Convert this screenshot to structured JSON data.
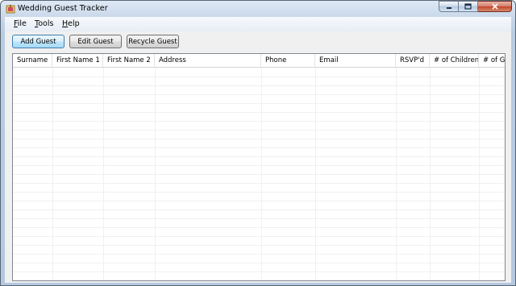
{
  "window": {
    "title": "Wedding Guest Tracker",
    "icon": "wedding-app-icon",
    "controls": {
      "minimize_icon": "minimize-icon",
      "maximize_icon": "maximize-icon",
      "close_icon": "close-icon"
    }
  },
  "menu": {
    "items": [
      {
        "label": "File",
        "mnemonic": "F"
      },
      {
        "label": "Tools",
        "mnemonic": "T"
      },
      {
        "label": "Help",
        "mnemonic": "H"
      }
    ]
  },
  "toolbar": {
    "add_label": "Add Guest",
    "edit_label": "Edit Guest",
    "recycle_label": "Recycle Guest"
  },
  "grid": {
    "columns": [
      "Surname",
      "First Name 1",
      "First Name 2",
      "Address",
      "Phone",
      "Email",
      "RSVP'd",
      "# of Children",
      "# of Guests"
    ],
    "rows": []
  },
  "colors": {
    "title_glass": "#c9d8ea",
    "client_bg": "#f0f0f0",
    "grid_border": "#828790",
    "default_button_accent": "#3c7fb1",
    "close_button": "#c2452b"
  }
}
